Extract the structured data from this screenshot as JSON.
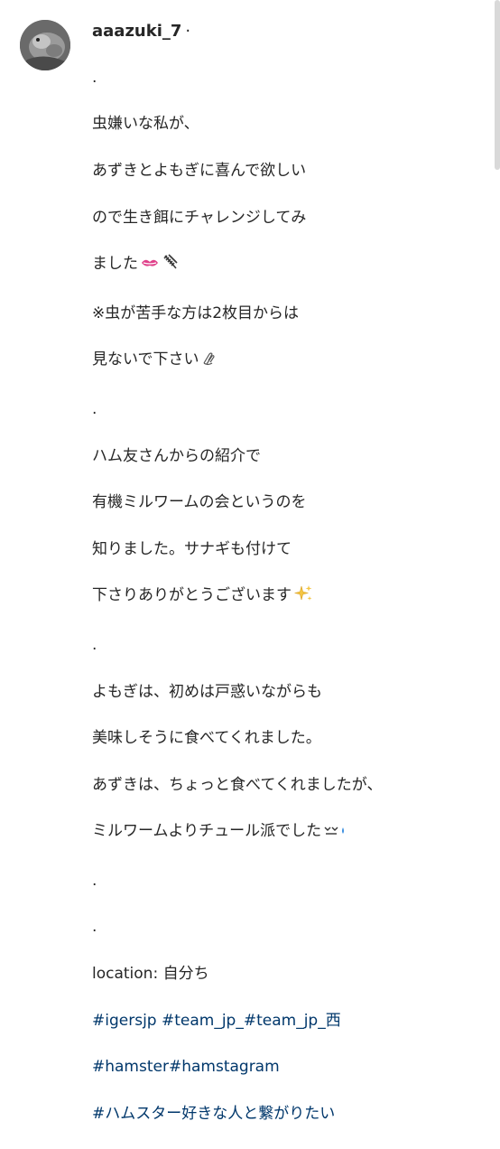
{
  "post": {
    "username": "aaazuki_7",
    "header_separator": "·",
    "caption_lines": [
      ".",
      "虫嫌いな私が、",
      "あずきとよもぎに喜んで欲しい",
      "ので生き餌にチャレンジしてみ",
      "ました",
      "※虫が苦手な方は2枚目からは",
      "見ないで下さい",
      ".",
      "ハム友さんからの紹介で",
      "有機ミルワームの会というのを",
      "知りました。サナギも付けて",
      "下さりありがとうございます",
      ".",
      "よもぎは、初めは戸惑いながらも",
      "美味しそうに食べてくれました。",
      "あずきは、ちょっと食べてくれましたが、",
      "ミルワームよりチュール派でした",
      ".",
      "."
    ],
    "location_line": "location: 自分ち",
    "hashtag_lines": [
      "#igersjp #team_jp_#team_jp_西",
      "#hamster#hamstagram",
      "#ハムスター好きな人と繋がりたい"
    ],
    "emojis": {
      "line_4": [
        "kiss-face-icon",
        "bug-icon"
      ],
      "line_6": "raised-hand-icon",
      "line_11": "sparkles-icon",
      "line_16": "sweat-smile-icon"
    }
  },
  "colors": {
    "text": "#262626",
    "hashtag": "#00376b",
    "scrollbar": "#d9d9d9"
  }
}
